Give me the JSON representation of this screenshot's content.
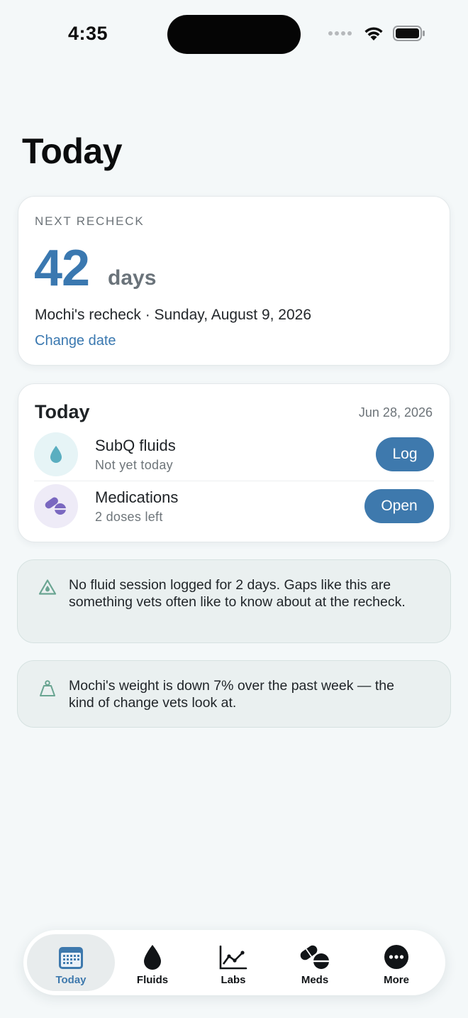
{
  "status_bar": {
    "time": "4:35"
  },
  "page": {
    "title": "Today"
  },
  "recheck": {
    "label": "NEXT RECHECK",
    "count": "42",
    "unit": "days",
    "description": "Mochi's recheck · Sunday, August 9, 2026",
    "change_date_label": "Change date"
  },
  "today_card": {
    "title": "Today",
    "date": "Jun 28, 2026",
    "tasks": [
      {
        "title": "SubQ fluids",
        "subtitle": "Not yet today",
        "action": "Log",
        "icon": "water-drop-icon"
      },
      {
        "title": "Medications",
        "subtitle": "2 doses left",
        "action": "Open",
        "icon": "pills-icon"
      }
    ]
  },
  "alerts": [
    {
      "icon": "warning-triangle-icon",
      "text": "No fluid session logged for 2 days. Gaps like this are something vets often like to know about at the recheck."
    },
    {
      "icon": "weight-scale-icon",
      "text": "Mochi's weight is down 7% over the past week — the kind of change vets look at."
    }
  ],
  "tab_bar": {
    "active": "Today",
    "tabs": [
      {
        "label": "Today",
        "icon": "calendar-icon"
      },
      {
        "label": "Fluids",
        "icon": "drop-icon"
      },
      {
        "label": "Labs",
        "icon": "line-chart-icon"
      },
      {
        "label": "Meds",
        "icon": "pills-icon"
      },
      {
        "label": "More",
        "icon": "more-icon"
      }
    ]
  },
  "colors": {
    "accent": "#3e79ad",
    "background": "#f4f8f9",
    "alert_background": "#eaf0f0",
    "fluid_icon": "#5aaec0",
    "med_icon": "#7a68c0",
    "alert_icon": "#6aa592"
  }
}
